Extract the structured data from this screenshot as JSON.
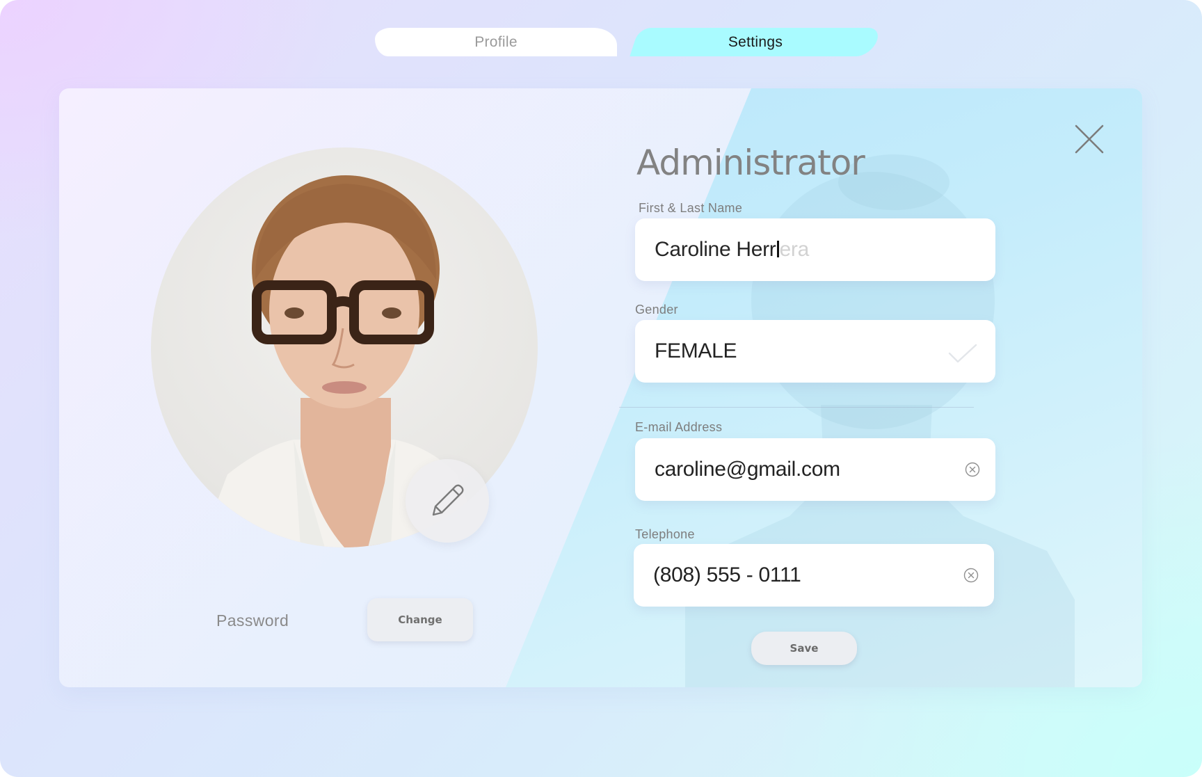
{
  "tabs": [
    {
      "label": "Profile",
      "active": false
    },
    {
      "label": "Settings",
      "active": true
    }
  ],
  "profile": {
    "title": "Administrator",
    "avatar_alt": "profile photo",
    "password_label": "Password",
    "change_label": "Change",
    "save_label": "Save"
  },
  "fields": {
    "name": {
      "label": "First & Last Name",
      "value_typed": "Caroline Herr",
      "value_suggestion": "era"
    },
    "gender": {
      "label": "Gender",
      "value": "FEMALE"
    },
    "email": {
      "label": "E-mail Address",
      "value": "caroline@gmail.com"
    },
    "telephone": {
      "label": "Telephone",
      "value": "(808) 555 - 0111"
    }
  },
  "icons": {
    "close": "close-icon",
    "edit": "pencil-icon",
    "check": "check-icon",
    "clear": "clear-circle-icon"
  },
  "colors": {
    "active_tab": "#a9fbff",
    "inactive_tab": "#ffffff",
    "title": "#828282"
  }
}
